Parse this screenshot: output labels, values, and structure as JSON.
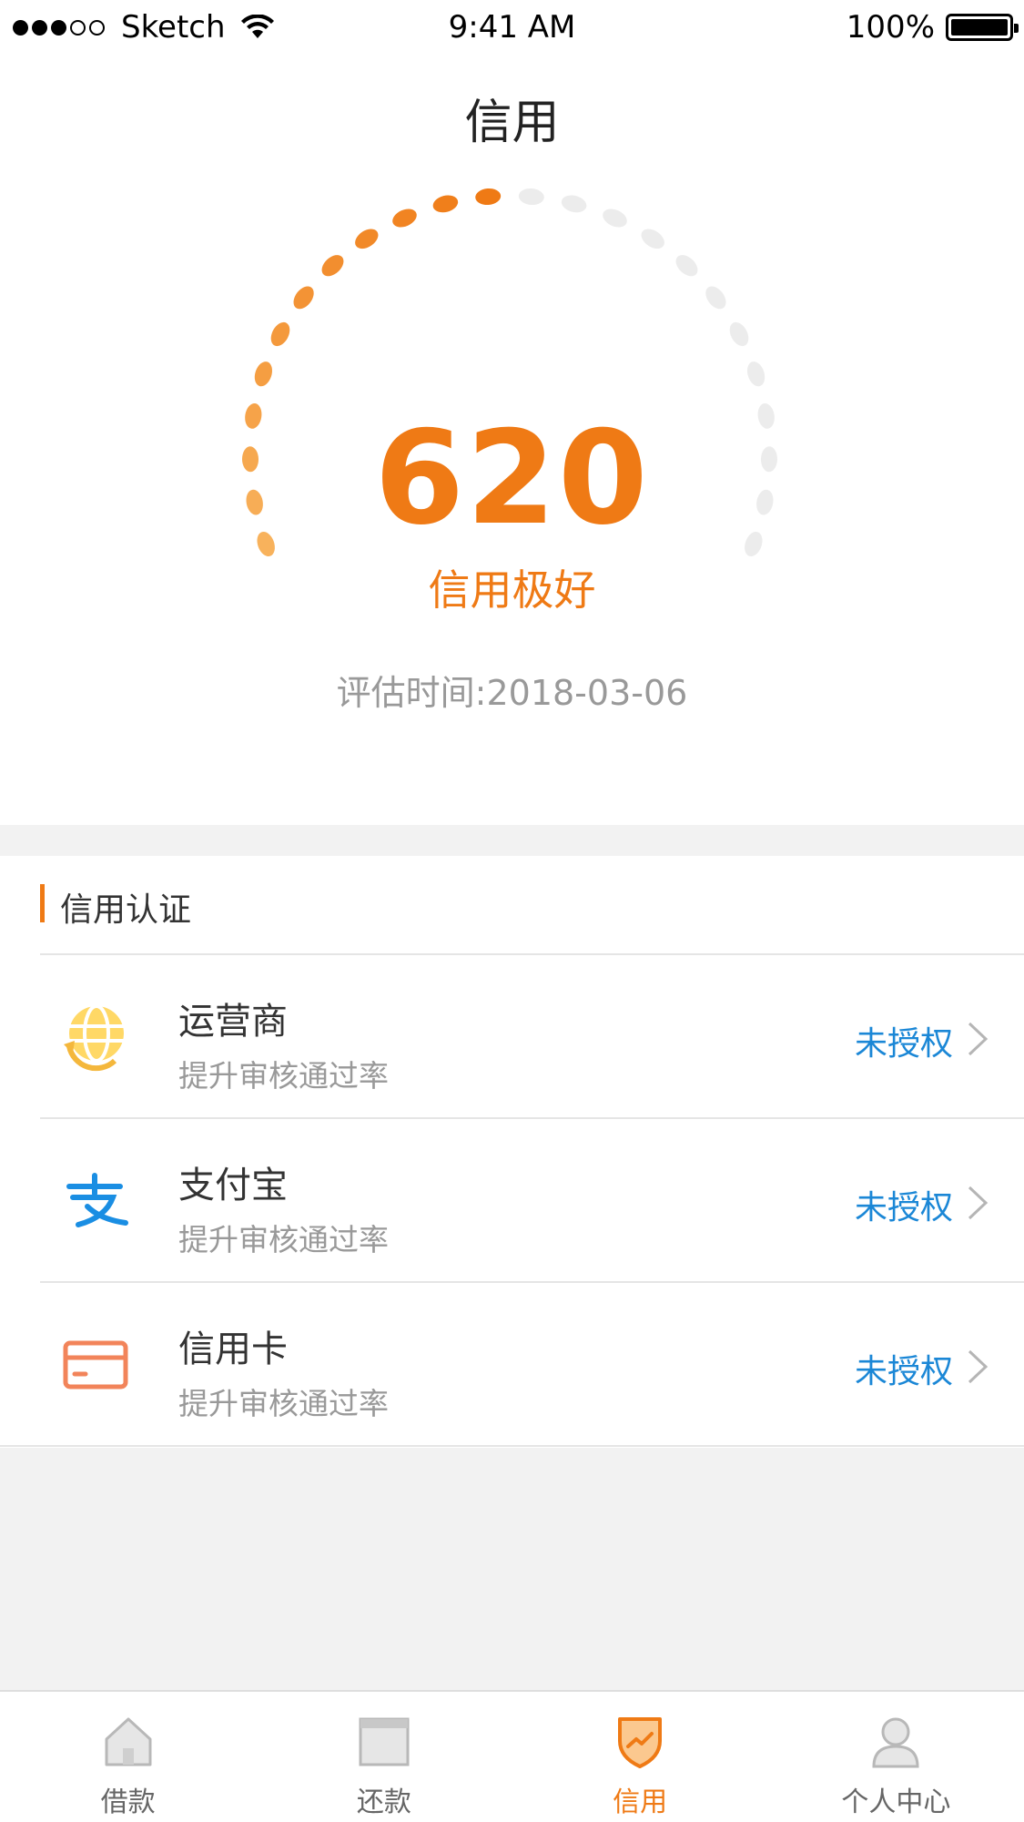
{
  "status_bar": {
    "carrier": "Sketch",
    "time": "9:41 AM",
    "battery": "100%"
  },
  "nav": {
    "title": "信用"
  },
  "credit": {
    "score": "620",
    "level": "信用极好",
    "eval_time": "评估时间:2018-03-06",
    "gauge_fill_fraction": 0.5,
    "accent_color": "#ef7a15"
  },
  "section": {
    "title": "信用认证"
  },
  "items": [
    {
      "title": "运营商",
      "subtitle": "提升审核通过率",
      "status": "未授权",
      "icon": "globe-refresh-icon"
    },
    {
      "title": "支付宝",
      "subtitle": "提升审核通过率",
      "status": "未授权",
      "icon": "alipay-icon"
    },
    {
      "title": "信用卡",
      "subtitle": "提升审核通过率",
      "status": "未授权",
      "icon": "credit-card-icon"
    }
  ],
  "tabs": [
    {
      "label": "借款",
      "icon": "house-icon",
      "active": false
    },
    {
      "label": "还款",
      "icon": "bill-icon",
      "active": false
    },
    {
      "label": "信用",
      "icon": "shield-chart-icon",
      "active": true
    },
    {
      "label": "个人中心",
      "icon": "person-icon",
      "active": false
    }
  ]
}
